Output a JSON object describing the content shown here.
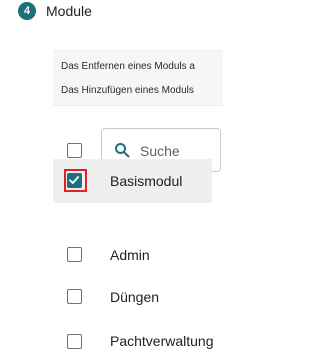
{
  "step": {
    "number": "4",
    "title": "Module"
  },
  "info": {
    "line1": "Das Entfernen eines Moduls a",
    "line2": "Das Hinzufügen eines Moduls"
  },
  "search": {
    "placeholder": "Suche",
    "value": ""
  },
  "select_all": {
    "checked": false
  },
  "modules": [
    {
      "label": "Basismodul",
      "checked": true,
      "focused": true
    },
    {
      "label": "Admin",
      "checked": false
    },
    {
      "label": "Düngen",
      "checked": false
    },
    {
      "label": "Pachtverwaltung",
      "checked": false
    }
  ],
  "colors": {
    "accent": "#1f6f7a",
    "focus": "#e3202a",
    "selected_row": "#efefef"
  },
  "icons": {
    "search": "search-icon",
    "check": "check-icon"
  }
}
